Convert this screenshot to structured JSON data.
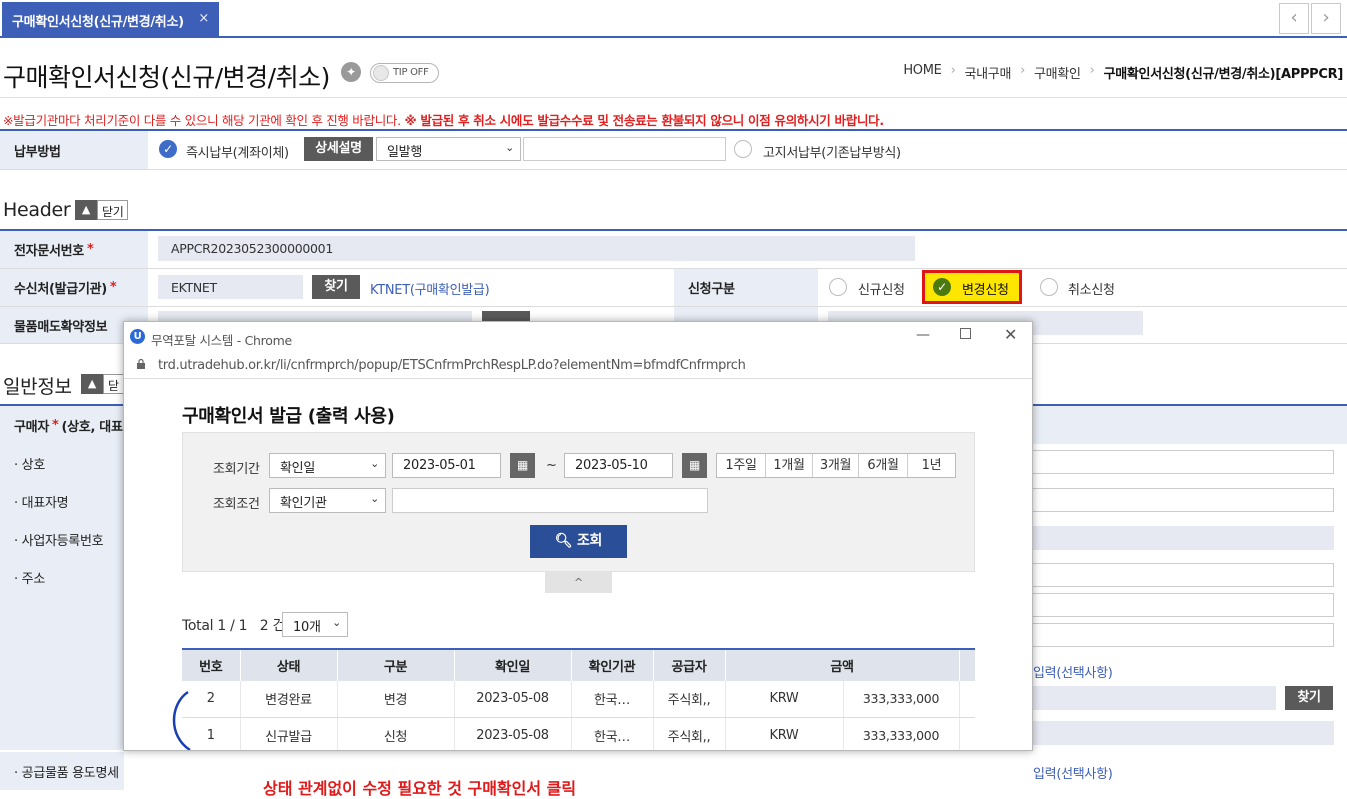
{
  "tabbar": {
    "active_tab": "구매확인서신청(신규/변경/취소)",
    "close": "×",
    "prev": "‹",
    "next": "›"
  },
  "header": {
    "title": "구매확인서신청(신규/변경/취소)",
    "tip_label": "TIP OFF",
    "breadcrumb": [
      "HOME",
      "국내구매",
      "구매확인",
      "구매확인서신청(신규/변경/취소)[APPPCR]"
    ]
  },
  "notice": {
    "part1": "※발급기관마다 처리기준이 다를 수 있으니 해당 기관에 확인 후 진행 바랍니다. ",
    "part2": "※ 발급된 후 취소 시에도 발급수수료 및 전송료는 환불되지 않으니 이점 유의하시기 바랍니다."
  },
  "payment": {
    "label": "납부방법",
    "option1": "즉시납부(계좌이체)",
    "detail_button": "상세설명",
    "select_value": "일발행",
    "option2": "고지서납부(기존납부방식)"
  },
  "header_section": {
    "title": "Header",
    "close_label": "닫기",
    "doc_no_label": "전자문서번호",
    "doc_no_value": "APPCR2023052300000001",
    "receiver_label": "수신처(발급기관)",
    "receiver_value": "EKTNET",
    "find_button": "찾기",
    "receiver_link": "KTNET(구매확인발급)",
    "apply_type_label": "신청구분",
    "apply_new": "신규신청",
    "apply_change": "변경신청",
    "apply_cancel": "취소신청",
    "contract_label": "물품매도확약정보"
  },
  "general_section": {
    "title": "일반정보",
    "close_label": "닫",
    "buyer_label": "구매자",
    "buyer_label_rest": "(상호, 대표",
    "rows": [
      "· 상호",
      "· 대표자명",
      "· 사업자등록번호",
      "· 주소"
    ],
    "usage_label": "· 공급물품 용도명세",
    "optional_input": "입력(선택사항)",
    "find_button": "찾기"
  },
  "popup": {
    "window_title": "무역포탈 시스템 - Chrome",
    "url": "trd.utradehub.or.kr/li/cnfrmprch/popup/ETSCnfrmPrchRespLP.do?elementNm=bfmdfCnfrmprch",
    "heading": "구매확인서 발급 (출력 사용)",
    "period_label": "조회기간",
    "period_type": "확인일",
    "date_from": "2023-05-01",
    "date_sep": "~",
    "date_to": "2023-05-10",
    "ranges": [
      "1주일",
      "1개월",
      "3개월",
      "6개월",
      "1년"
    ],
    "cond_label": "조회조건",
    "cond_type": "확인기관",
    "search_button": "조회",
    "collapse": "^",
    "total_text": "Total 1 / 1   2 건",
    "page_size": "10개",
    "columns": [
      "번호",
      "상태",
      "구분",
      "확인일",
      "확인기관",
      "공급자",
      "금액"
    ],
    "rows": [
      {
        "no": "2",
        "status": "변경완료",
        "type": "변경",
        "date": "2023-05-08",
        "org": "한국…",
        "supplier": "주식회,,",
        "currency": "KRW",
        "amount": "333,333,000"
      },
      {
        "no": "1",
        "status": "신규발급",
        "type": "신청",
        "date": "2023-05-08",
        "org": "한국…",
        "supplier": "주식회,,",
        "currency": "KRW",
        "amount": "333,333,000"
      }
    ]
  },
  "annotation": "상태 관계없이 수정 필요한 것 구매확인서 클릭",
  "colors": {
    "accent": "#3d5fb7",
    "highlight": "#ffe600",
    "annotation_red": "#e01a1a"
  }
}
